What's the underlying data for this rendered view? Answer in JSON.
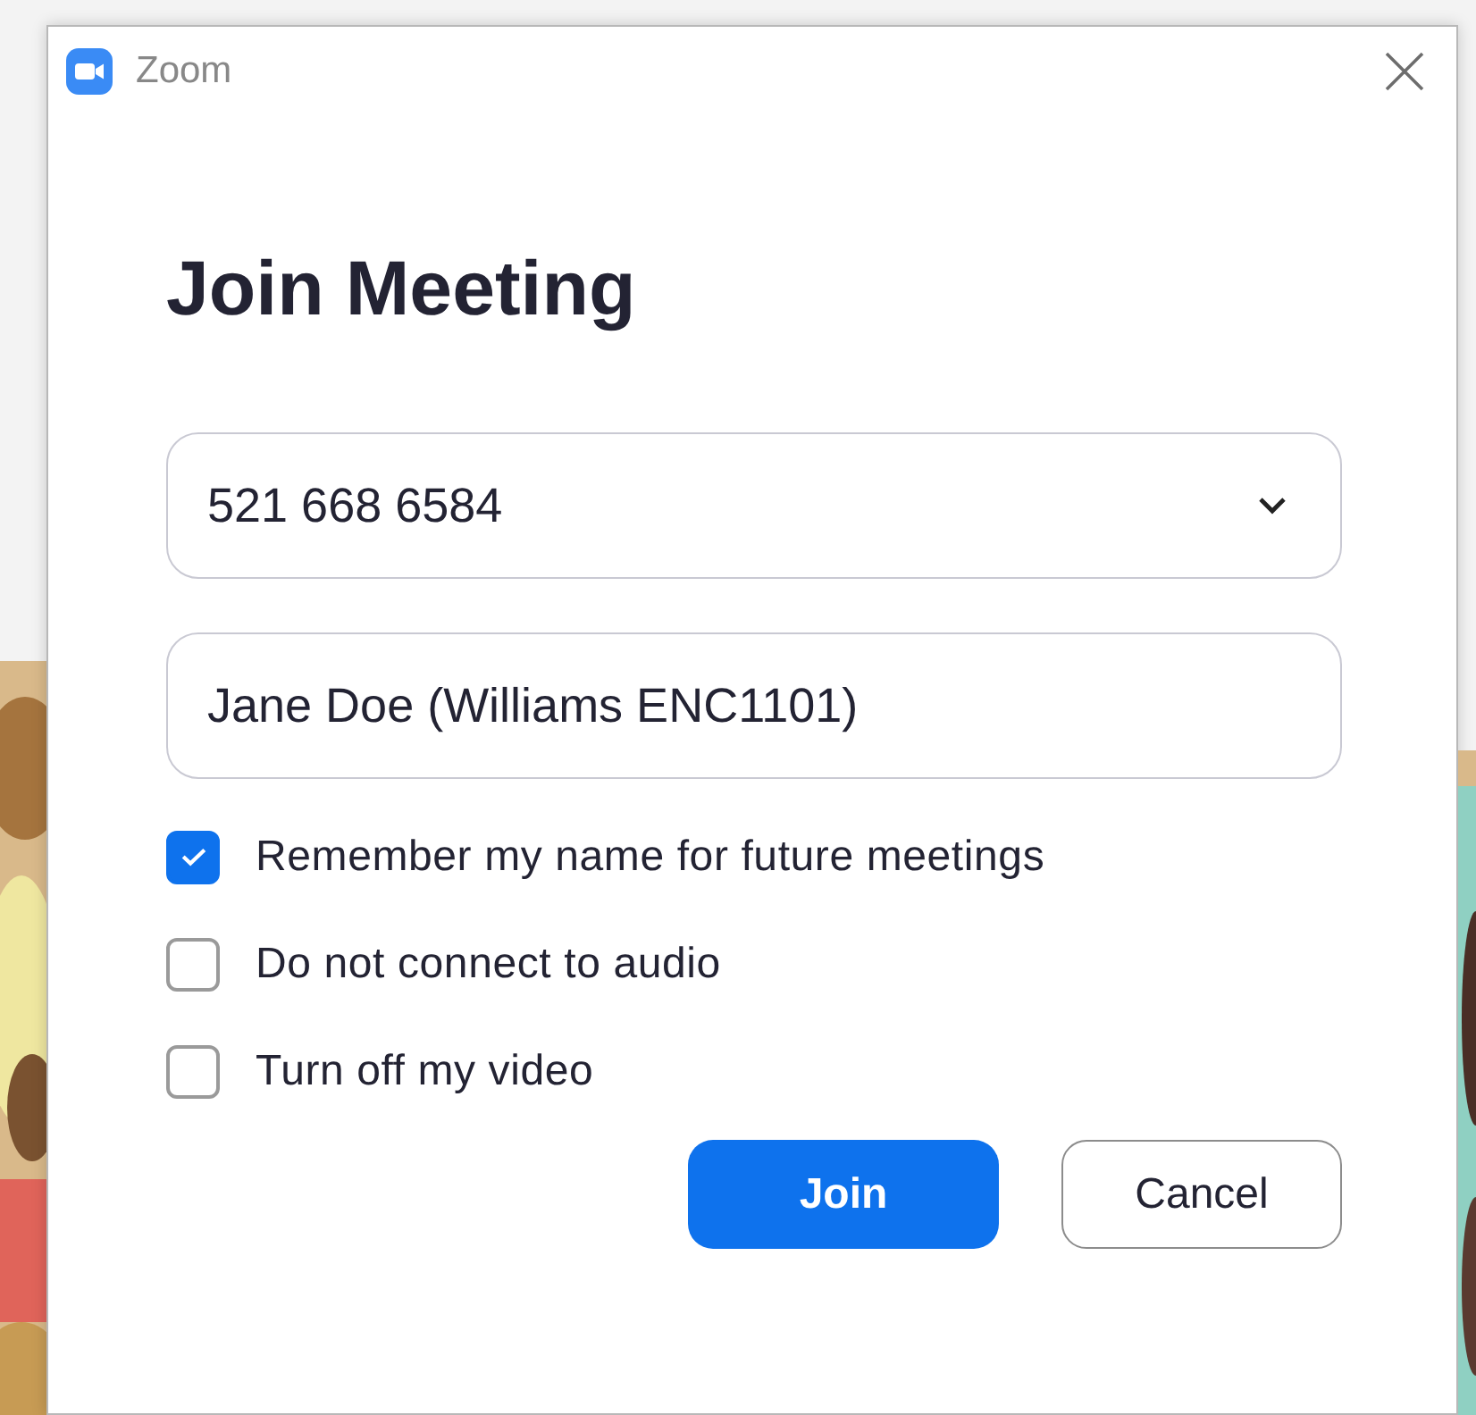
{
  "window": {
    "title": "Zoom"
  },
  "heading": "Join Meeting",
  "meeting_id": {
    "value": "521 668 6584"
  },
  "name": {
    "value": "Jane Doe (Williams ENC1101)"
  },
  "options": [
    {
      "label": "Remember my name for future meetings",
      "checked": true
    },
    {
      "label": "Do not connect to audio",
      "checked": false
    },
    {
      "label": "Turn off my video",
      "checked": false
    }
  ],
  "buttons": [
    {
      "label": "Join",
      "kind": "primary"
    },
    {
      "label": "Cancel",
      "kind": "secondary"
    }
  ]
}
